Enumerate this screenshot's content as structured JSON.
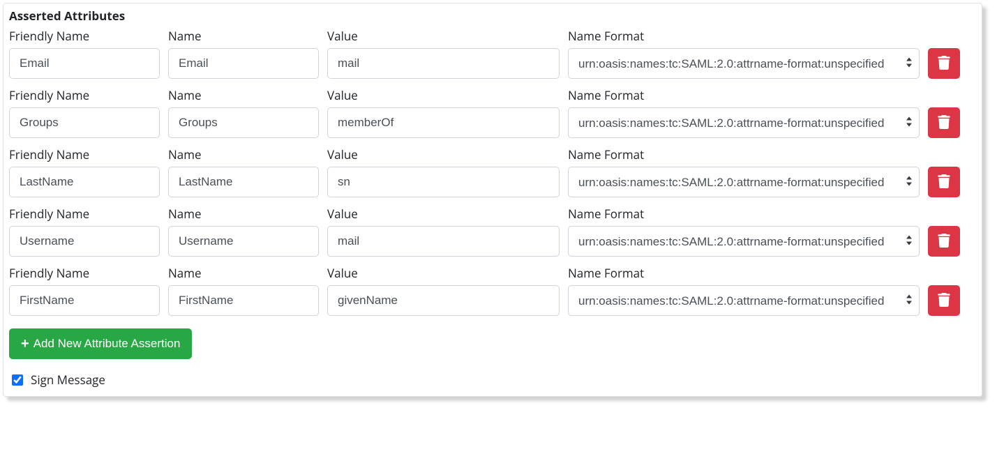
{
  "section_title": "Asserted Attributes",
  "labels": {
    "friendly_name": "Friendly Name",
    "name": "Name",
    "value": "Value",
    "name_format": "Name Format"
  },
  "name_format_display": "urn:oasis:names:tc:SAML:2.0:attrname-format:unspecif",
  "rows": [
    {
      "friendly": "Email",
      "name": "Email",
      "value": "mail",
      "format": "urn:oasis:names:tc:SAML:2.0:attrname-format:unspecified"
    },
    {
      "friendly": "Groups",
      "name": "Groups",
      "value": "memberOf",
      "format": "urn:oasis:names:tc:SAML:2.0:attrname-format:unspecified"
    },
    {
      "friendly": "LastName",
      "name": "LastName",
      "value": "sn",
      "format": "urn:oasis:names:tc:SAML:2.0:attrname-format:unspecified"
    },
    {
      "friendly": "Username",
      "name": "Username",
      "value": "mail",
      "format": "urn:oasis:names:tc:SAML:2.0:attrname-format:unspecified"
    },
    {
      "friendly": "FirstName",
      "name": "FirstName",
      "value": "givenName",
      "format": "urn:oasis:names:tc:SAML:2.0:attrname-format:unspecified"
    }
  ],
  "add_button_label": "Add New Attribute Assertion",
  "sign_message_label": "Sign Message",
  "sign_message_checked": true
}
